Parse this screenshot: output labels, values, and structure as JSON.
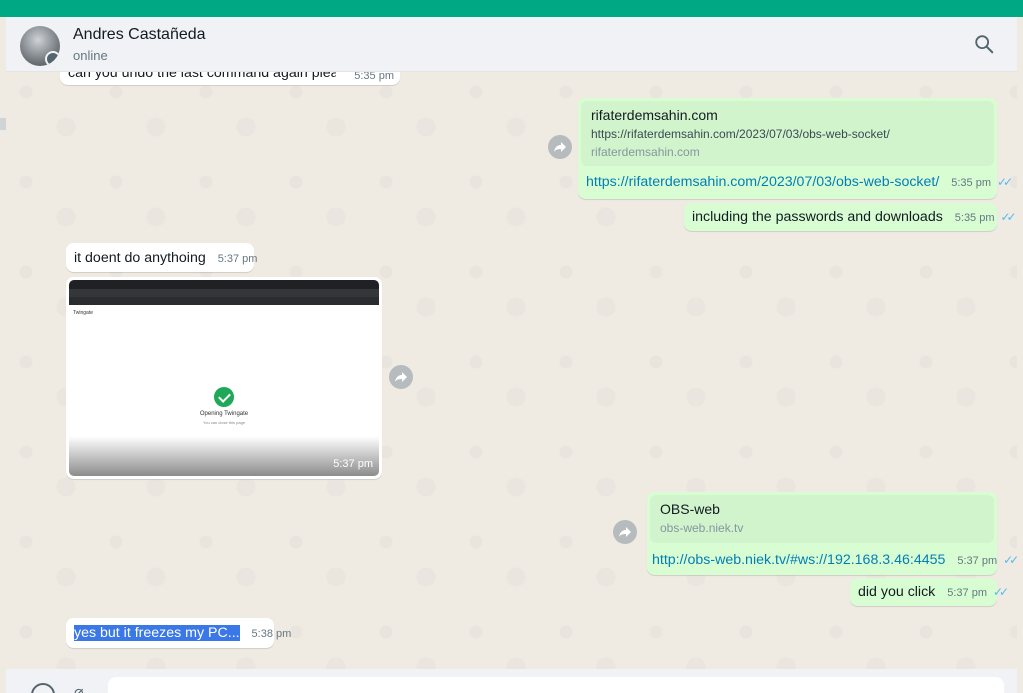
{
  "header": {
    "contact_name": "Andres Castañeda",
    "status": "online"
  },
  "messages": {
    "partial_top": {
      "text": "can you undo the last command again please",
      "time": "5:35 pm"
    },
    "link1": {
      "preview_title": "rifaterdemsahin.com",
      "preview_desc": "https://rifaterdemsahin.com/2023/07/03/obs-web-socket/",
      "preview_domain": "rifaterdemsahin.com",
      "url": "https://rifaterdemsahin.com/2023/07/03/obs-web-socket/",
      "time": "5:35 pm"
    },
    "passwords": {
      "text": "including the passwords and downloads",
      "time": "5:35 pm"
    },
    "doesnt_do": {
      "text": "it doent do anythoing",
      "time": "5:37 pm"
    },
    "image": {
      "time": "5:37 pm",
      "logo_text": "Twingate",
      "title": "Opening Twingate",
      "subtitle": "You can close this page"
    },
    "link2": {
      "preview_title": "OBS-web",
      "preview_domain": "obs-web.niek.tv",
      "url": "http://obs-web.niek.tv/#ws://192.168.3.46:4455",
      "time": "5:37 pm"
    },
    "did_you_click": {
      "text": "did you click",
      "time": "5:37 pm"
    },
    "freezes": {
      "text": "yes but it freezes my PC...",
      "time": "5:38 pm"
    }
  },
  "colors": {
    "accent": "#00a884",
    "outgoing": "#d9fdd3",
    "incoming": "#ffffff",
    "chat_bg": "#efeae2",
    "link": "#027eb5",
    "read_ticks": "#53bdeb"
  },
  "icons": {
    "search": "search-icon",
    "forward": "forward-icon",
    "emoji": "emoji-icon",
    "attach": "attach-icon",
    "read": "double-check-icon"
  }
}
